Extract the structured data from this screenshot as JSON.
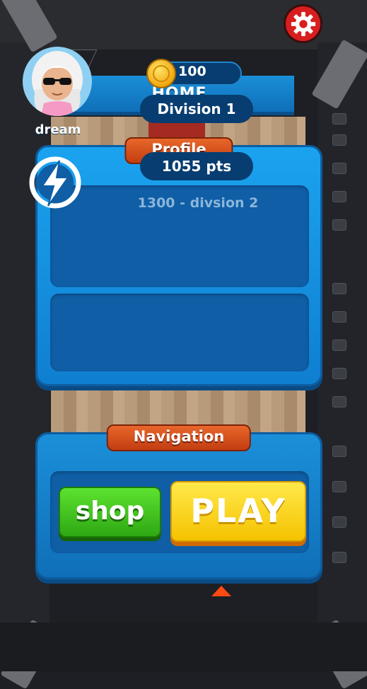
{
  "header": {
    "title": "HOME"
  },
  "profile": {
    "tab_label": "Profile",
    "username": "dream",
    "coins": "100",
    "division": "Division 1",
    "points": "1055 pts",
    "next_division": "1300 - divsion 2"
  },
  "navigation": {
    "tab_label": "Navigation",
    "shop_label": "shop",
    "play_label": "PLAY"
  },
  "icons": {
    "settings": "gear-icon",
    "coin": "coin-icon",
    "rank": "lightning-bolt-icon",
    "avatar": "avatar-image"
  },
  "colors": {
    "panel_blue": "#1ba3ef",
    "tab_orange": "#e8672a",
    "shop_green": "#2ea814",
    "play_yellow": "#f5c200",
    "settings_red": "#d81e1e"
  }
}
